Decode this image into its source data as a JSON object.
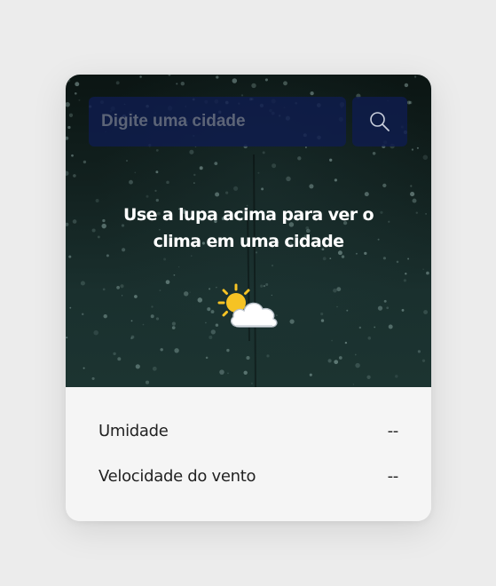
{
  "search": {
    "placeholder": "Digite uma cidade",
    "value": ""
  },
  "icons": {
    "search_button": "search-icon",
    "weather": "sun-behind-cloud-icon"
  },
  "hint": {
    "line1": "Use a lupa acima para ver o",
    "line2": "clima em uma cidade"
  },
  "details": {
    "humidity": {
      "label": "Umidade",
      "value": "--"
    },
    "wind": {
      "label": "Velocidade do vento",
      "value": "--"
    }
  },
  "colors": {
    "page_background": "#ececec",
    "search_background": "#0f1c4e",
    "hero_dark": "#0b1513",
    "hero_teal": "#1c3431",
    "panel_background": "#f5f5f5",
    "sun": "#f6c324"
  }
}
